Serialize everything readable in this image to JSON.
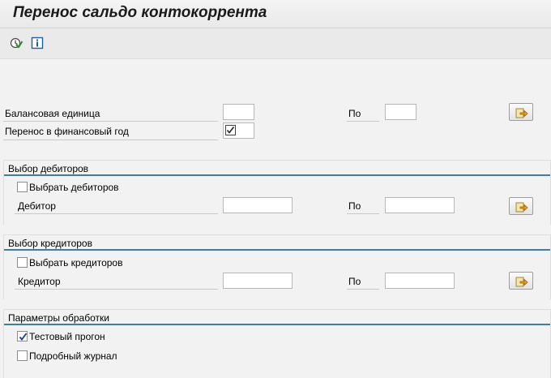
{
  "window": {
    "title": "Перенос сальдо контокоррента"
  },
  "toolbar": {
    "execute_icon": "execute-icon",
    "info_icon": "info-icon"
  },
  "main": {
    "company_code_label": "Балансовая единица",
    "company_code_from": "",
    "company_code_to_label": "По",
    "company_code_to": "",
    "fiscal_year_label": "Перенос в финансовый год",
    "fiscal_year_checked": true
  },
  "customers": {
    "group_title": "Выбор дебиторов",
    "select_label": "Выбрать дебиторов",
    "select_checked": false,
    "customer_label": "Дебитор",
    "customer_from": "",
    "to_label": "По",
    "customer_to": ""
  },
  "vendors": {
    "group_title": "Выбор кредиторов",
    "select_label": "Выбрать кредиторов",
    "select_checked": false,
    "vendor_label": "Кредитор",
    "vendor_from": "",
    "to_label": "По",
    "vendor_to": ""
  },
  "processing": {
    "group_title": "Параметры обработки",
    "test_run_label": "Тестовый прогон",
    "test_run_checked": true,
    "detail_log_label": "Подробный журнал",
    "detail_log_checked": false
  },
  "colors": {
    "group_underline": "#3b7fa8",
    "check_mark": "#1f3f7a"
  }
}
